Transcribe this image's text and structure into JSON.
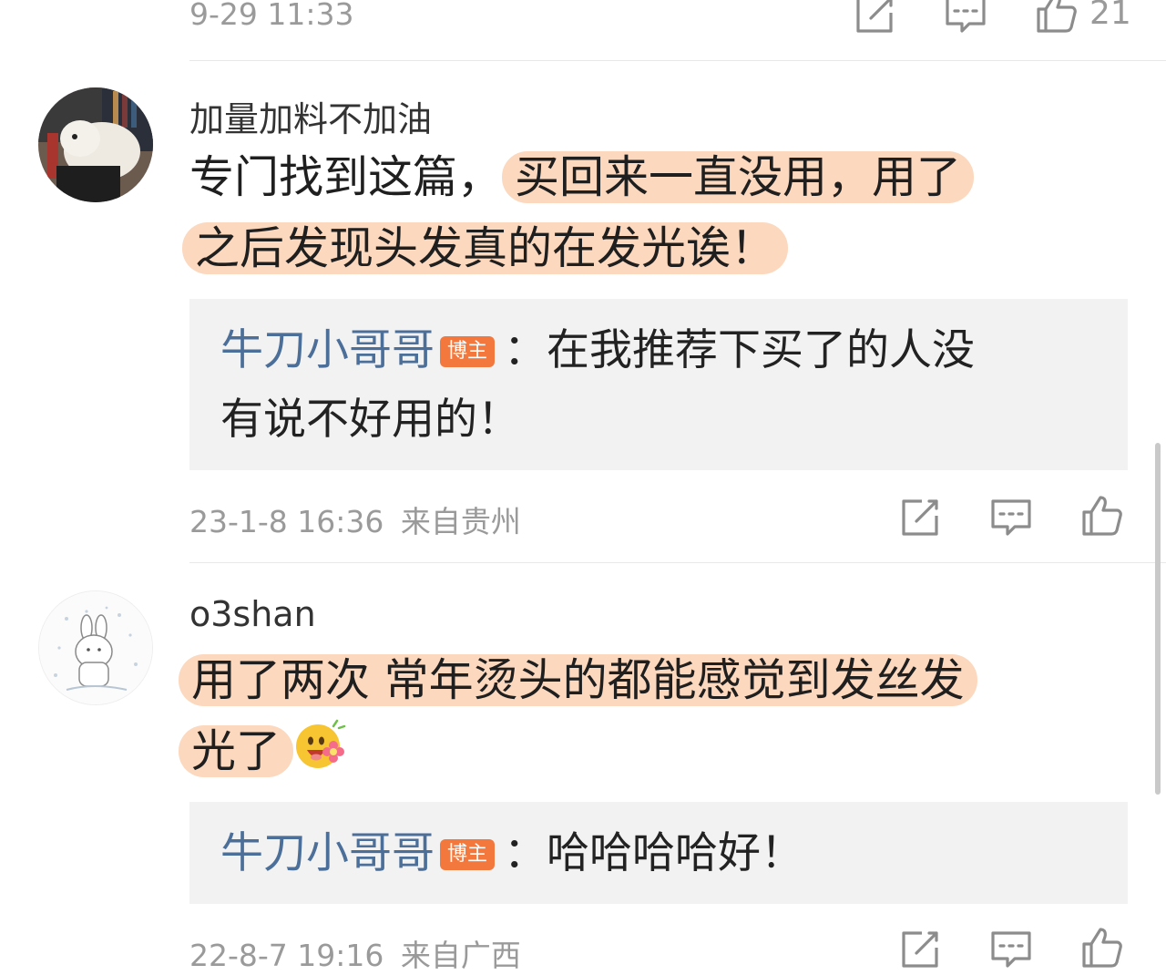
{
  "top_row": {
    "timestamp": "9-29 11:33",
    "like_count": "21"
  },
  "comments": [
    {
      "username": "加量加料不加油",
      "body_prefix": "专门找到这篇，",
      "body_highlight_1": "买回来一直没用，用了",
      "body_highlight_2": "之后发现头发真的在发光诶！",
      "reply": {
        "name": "牛刀小哥哥",
        "badge": "博主",
        "text_1": "：在我推荐下买了的人没",
        "text_2": "有说不好用的！"
      },
      "timestamp": "23-1-8 16:36",
      "location": "来自贵州"
    },
    {
      "username": "o3shan",
      "body_highlight_1": "用了两次 常年烫头的都能感觉到发丝发",
      "body_highlight_2": "光了",
      "emoji": "flower-smile-emoji",
      "reply": {
        "name": "牛刀小哥哥",
        "badge": "博主",
        "text_1": "：哈哈哈哈好！"
      },
      "timestamp": "22-8-7 19:16",
      "location": "来自广西"
    }
  ],
  "icons": {
    "repost": "repost-icon",
    "comment": "comment-icon",
    "like": "thumbs-up-icon"
  },
  "colors": {
    "highlight": "#fbcba8",
    "reply_name": "#4c6f99",
    "badge": "#f3783d",
    "reply_bg": "#f2f2f2"
  }
}
